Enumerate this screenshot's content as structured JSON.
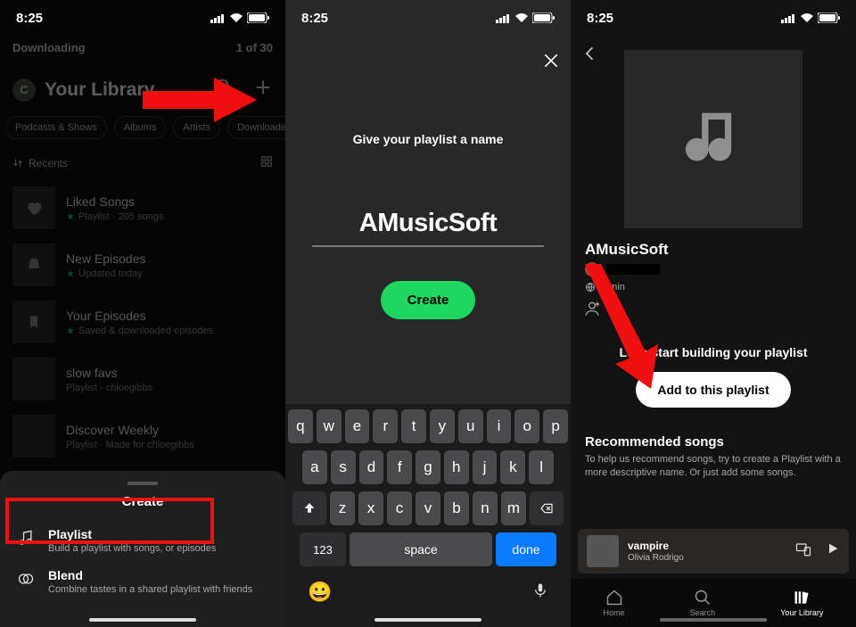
{
  "status": {
    "time": "8:25"
  },
  "p1": {
    "downloading": "Downloading",
    "progress": "1 of 30",
    "avatar_initial": "C",
    "library_title": "Your Library",
    "chips": [
      "Podcasts & Shows",
      "Albums",
      "Artists",
      "Downloaded"
    ],
    "recents": "Recents",
    "items": [
      {
        "title": "Liked Songs",
        "sub": "Playlist · 205 songs",
        "pinned": true,
        "icon": "heart"
      },
      {
        "title": "New Episodes",
        "sub": "Updated today",
        "pinned": true,
        "icon": "bell"
      },
      {
        "title": "Your Episodes",
        "sub": "Saved & downloaded episodes",
        "pinned": true,
        "icon": "bookmark"
      },
      {
        "title": "slow favs",
        "sub": "Playlist · chloegibbs",
        "pinned": false,
        "icon": "blank"
      },
      {
        "title": "Discover Weekly",
        "sub": "Playlist · Made for chloegibbs",
        "pinned": false,
        "icon": "blank"
      }
    ],
    "sheet": {
      "heading": "Create",
      "rows": [
        {
          "title": "Playlist",
          "sub": "Build a playlist with songs, or episodes"
        },
        {
          "title": "Blend",
          "sub": "Combine tastes in a shared playlist with friends"
        }
      ]
    }
  },
  "p2": {
    "prompt": "Give your playlist a name",
    "name": "AMusicSoft",
    "create": "Create",
    "keys": {
      "r1": [
        "q",
        "w",
        "e",
        "r",
        "t",
        "y",
        "u",
        "i",
        "o",
        "p"
      ],
      "r2": [
        "a",
        "s",
        "d",
        "f",
        "g",
        "h",
        "j",
        "k",
        "l"
      ],
      "r3": [
        "z",
        "x",
        "c",
        "v",
        "b",
        "n",
        "m"
      ],
      "num": "123",
      "space": "space",
      "done": "done"
    }
  },
  "p3": {
    "title": "AMusicSoft",
    "meta_vis": "0 min",
    "build": "Let's start building your playlist",
    "add": "Add to this playlist",
    "rec_h": "Recommended songs",
    "rec_p": "To help us recommend songs, try to create a Playlist with a more descriptive name. Or just add some songs.",
    "np": {
      "title": "vampire",
      "artist": "Olivia Rodrigo"
    },
    "tabs": {
      "home": "Home",
      "search": "Search",
      "library": "Your Library"
    }
  }
}
